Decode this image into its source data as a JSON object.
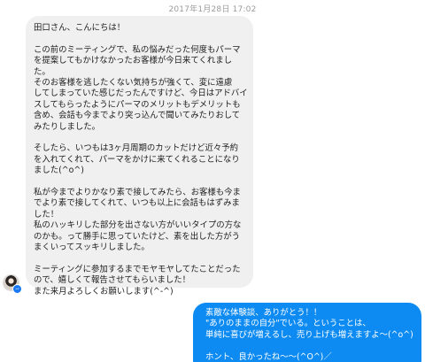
{
  "timestamp": "2017年1月28日 17:02",
  "incoming": {
    "sender_avatar": "profile-photo",
    "lines": [
      "田口さん、こんにちは！",
      "",
      "この前のミーティングで、私の悩みだった何度もパーマ",
      "を提案してもかけなかったお客様が今日来てくれまし",
      "た。",
      "そのお客様を逃したくない気持ちが強くて、変に遠慮",
      "してしまっていた感じだったんですけど、今日はアドバイ",
      "スしてもらったようにパーマのメリットもデメリットも",
      "含め、会話も今までより突っ込んで聞いてみたりおして",
      "みたりしました。",
      "",
      "そしたら、いつもは3ヶ月周期のカットだけど近々予約",
      "を入れてくれて、パーマをかけに来てくれることになり",
      "ました(^o^)",
      "",
      "私が今までよりかなり素で接してみたら、お客様も今ま",
      "でより素で接してくれて、いつも以上に会話もはずみま",
      "した！",
      "私のハッキリした部分を出さない方がいいタイプの方な",
      "のかも。って勝手に思っていたけど、素を出した方がう",
      "まくいってスッキリしました。",
      "",
      "ミーティングに参加するまでモヤモヤしてたことだった",
      "ので、嬉しくて報告させてもらいました！",
      "また来月よろしくお願いします(^-^)"
    ]
  },
  "outgoing": {
    "lines": [
      "素敵な体験談、ありがとう！！",
      "\"ありのままの自分\"でいる。ということは、",
      "単純に喜びが増えるし、売り上げも増えますよ〜(^o^)",
      "",
      "ホント、良かったね〜〜(^O^)／"
    ]
  },
  "colors": {
    "incoming_bubble": "#f1f0f0",
    "outgoing_bubble": "#0d8bf2",
    "badge": "#1877f2"
  }
}
